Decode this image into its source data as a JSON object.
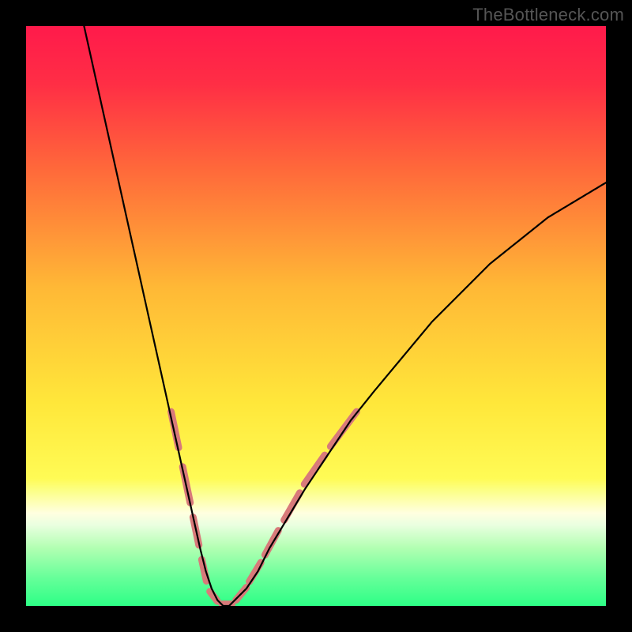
{
  "watermark": "TheBottleneck.com",
  "gradient_stops": [
    {
      "offset": 0.0,
      "color": "#ff1a4b"
    },
    {
      "offset": 0.1,
      "color": "#ff2e45"
    },
    {
      "offset": 0.25,
      "color": "#ff6a3a"
    },
    {
      "offset": 0.45,
      "color": "#ffb836"
    },
    {
      "offset": 0.65,
      "color": "#ffe73a"
    },
    {
      "offset": 0.78,
      "color": "#fffb55"
    },
    {
      "offset": 0.8,
      "color": "#fcff84"
    },
    {
      "offset": 0.84,
      "color": "#ffffe0"
    },
    {
      "offset": 0.86,
      "color": "#eaffe0"
    },
    {
      "offset": 0.9,
      "color": "#b2ffb2"
    },
    {
      "offset": 0.95,
      "color": "#68ff9a"
    },
    {
      "offset": 1.0,
      "color": "#2dff86"
    }
  ],
  "curve": {
    "stroke": "#000000",
    "stroke_width": 2.2
  },
  "segments": {
    "stroke": "#d87a7a",
    "stroke_width": 9,
    "linecap": "round"
  },
  "chart_data": {
    "type": "line",
    "title": "",
    "xlabel": "",
    "ylabel": "",
    "xlim": [
      0,
      100
    ],
    "ylim": [
      0,
      100
    ],
    "grid": false,
    "legend_position": "none",
    "series": [
      {
        "name": "bottleneck-curve",
        "x": [
          10,
          12,
          14,
          16,
          18,
          20,
          22,
          24,
          26,
          28,
          30,
          31,
          32,
          33,
          34,
          35,
          36,
          38,
          40,
          42,
          45,
          48,
          52,
          56,
          60,
          65,
          70,
          75,
          80,
          85,
          90,
          95,
          100
        ],
        "y": [
          100,
          91,
          82,
          73,
          64,
          55,
          46,
          37,
          28,
          19,
          10,
          6,
          3,
          1,
          0,
          0,
          1,
          3,
          6,
          10,
          15,
          20,
          26,
          32,
          37,
          43,
          49,
          54,
          59,
          63,
          67,
          70,
          73
        ]
      }
    ],
    "highlight_segments": [
      {
        "x0": 25,
        "y0": 33.5,
        "x1": 26.3,
        "y1": 27.3
      },
      {
        "x0": 27.0,
        "y0": 24.0,
        "x1": 28.3,
        "y1": 17.8
      },
      {
        "x0": 28.8,
        "y0": 15.3,
        "x1": 29.8,
        "y1": 10.5
      },
      {
        "x0": 30.3,
        "y0": 8.0,
        "x1": 31.1,
        "y1": 4.3
      },
      {
        "x0": 31.7,
        "y0": 2.5,
        "x1": 33.0,
        "y1": 0.8
      },
      {
        "x0": 33.8,
        "y0": 0.3,
        "x1": 35.5,
        "y1": 0.3
      },
      {
        "x0": 36.2,
        "y0": 1.0,
        "x1": 38.0,
        "y1": 3.2
      },
      {
        "x0": 38.5,
        "y0": 4.2,
        "x1": 40.5,
        "y1": 7.5
      },
      {
        "x0": 41.2,
        "y0": 8.8,
        "x1": 43.5,
        "y1": 13.0
      },
      {
        "x0": 44.5,
        "y0": 14.8,
        "x1": 47.2,
        "y1": 19.5
      },
      {
        "x0": 48.0,
        "y0": 21.0,
        "x1": 51.5,
        "y1": 26.0
      },
      {
        "x0": 52.5,
        "y0": 27.5,
        "x1": 57.0,
        "y1": 33.5
      }
    ],
    "gradient_semantics": "background-gradient-maps-y-to-bottleneck-severity-red-high-green-low"
  }
}
